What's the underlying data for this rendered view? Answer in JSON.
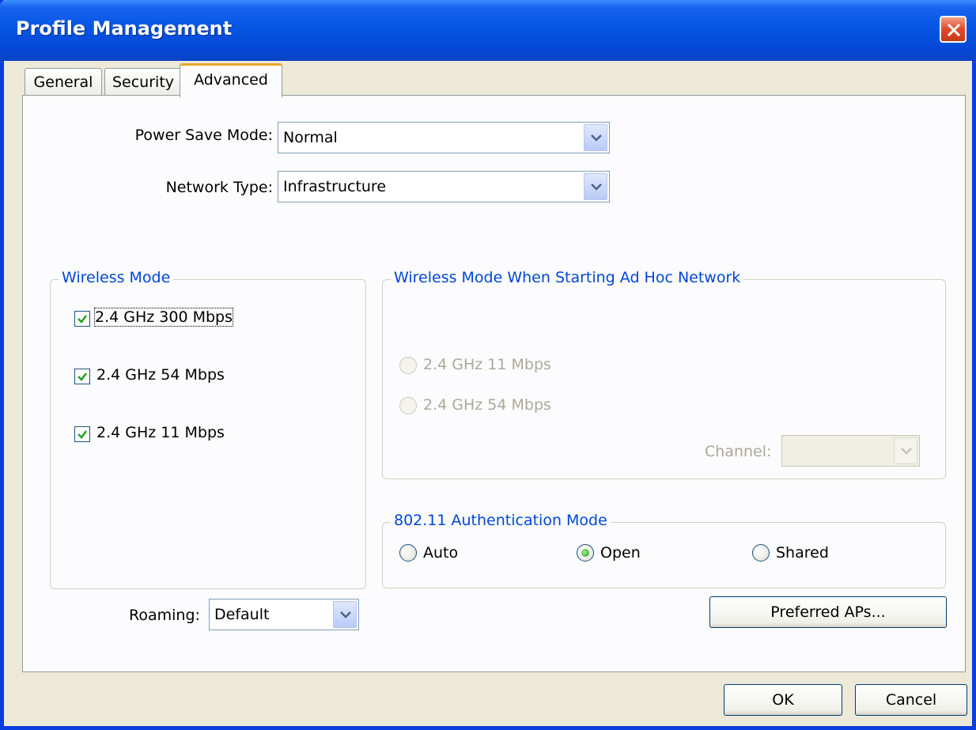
{
  "window": {
    "title": "Profile Management"
  },
  "tabs": [
    {
      "label": "General"
    },
    {
      "label": "Security"
    },
    {
      "label": "Advanced"
    }
  ],
  "power_save": {
    "label": "Power Save Mode:",
    "value": "Normal"
  },
  "network_type": {
    "label": "Network Type:",
    "value": "Infrastructure"
  },
  "wireless_mode": {
    "legend": "Wireless Mode",
    "options": [
      {
        "label": "2.4 GHz 300 Mbps",
        "checked": true
      },
      {
        "label": "2.4 GHz 54 Mbps",
        "checked": true
      },
      {
        "label": "2.4 GHz 11 Mbps",
        "checked": true
      }
    ]
  },
  "adhoc_mode": {
    "legend": "Wireless Mode When Starting Ad Hoc Network",
    "options": [
      {
        "label": "2.4 GHz 11 Mbps",
        "enabled": false
      },
      {
        "label": "2.4 GHz 54 Mbps",
        "enabled": false
      }
    ],
    "channel_label": "Channel:",
    "channel_value": ""
  },
  "auth_mode": {
    "legend": "802.11 Authentication Mode",
    "options": [
      {
        "label": "Auto",
        "selected": false
      },
      {
        "label": "Open",
        "selected": true
      },
      {
        "label": "Shared",
        "selected": false
      }
    ]
  },
  "roaming": {
    "label": "Roaming:",
    "value": "Default"
  },
  "buttons": {
    "preferred_aps": "Preferred APs...",
    "ok": "OK",
    "cancel": "Cancel"
  },
  "colors": {
    "titlebar": "#0857e6",
    "group_legend": "#0046d5",
    "check_mark": "#21a121",
    "disabled_text": "#aca899"
  }
}
